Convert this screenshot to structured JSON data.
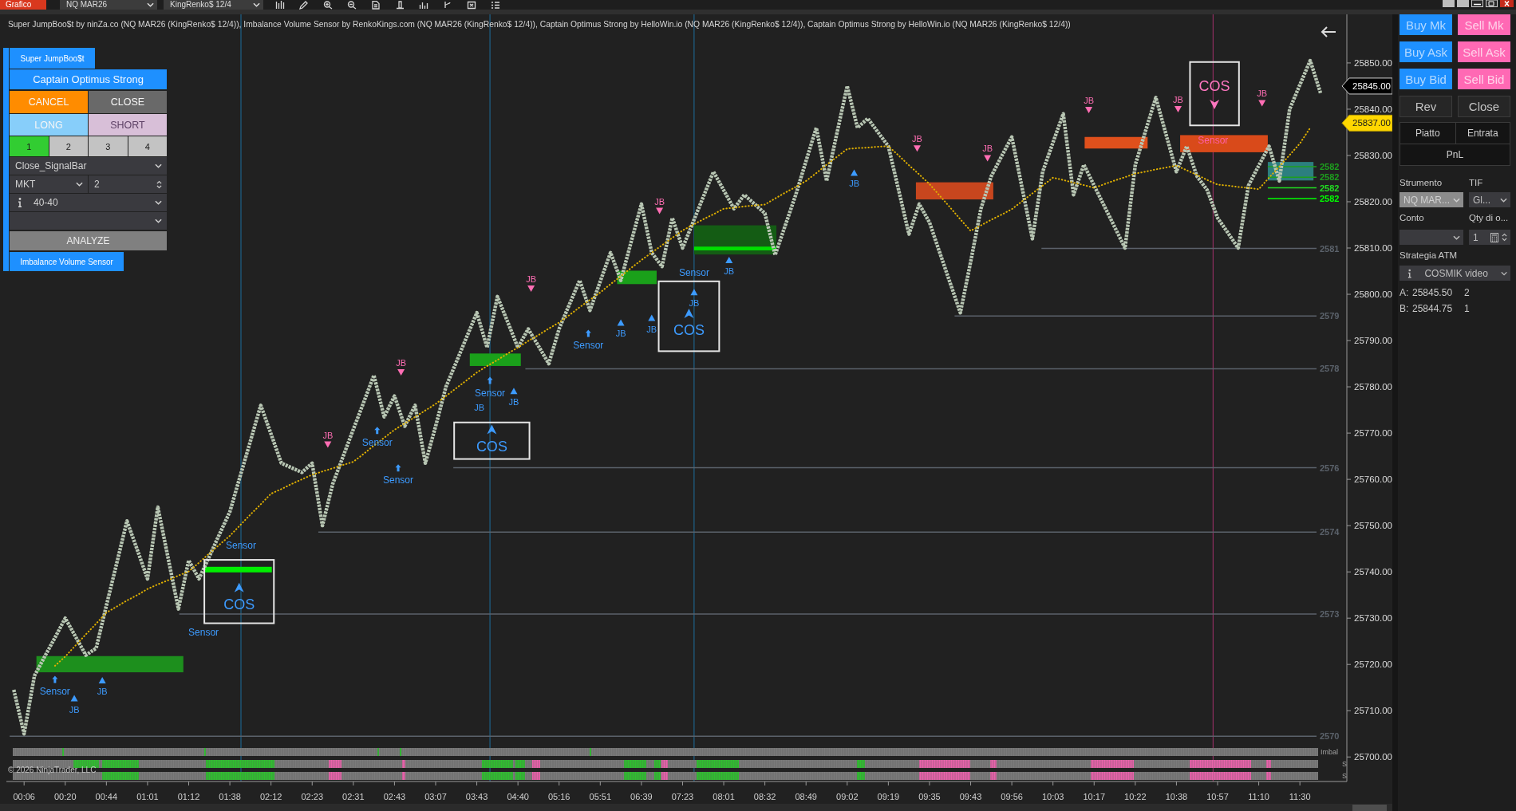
{
  "toolbar": {
    "tab": "Grafico",
    "instrument": "NQ MAR26",
    "bar_type": "KingRenko$ 12/4"
  },
  "chart": {
    "legend": "Super JumpBoo$t by ninZa.co (NQ MAR26 (KingRenko$ 12/4)), Imbalance Volume Sensor by RenkoKings.com (NQ MAR26 (KingRenko$ 12/4)), Captain Optimus Strong by HelloWin.io (NQ MAR26 (KingRenko$ 12/4)), Captain Optimus Strong by HelloWin.io (NQ MAR26 (KingRenko$ 12/4))",
    "strategy_panel": {
      "tab": "Super JumpBoo$t",
      "title": "Captain Optimus Strong",
      "actions": [
        {
          "label": "CANCEL",
          "color": "#ff8c00"
        },
        {
          "label": "CLOSE",
          "color": "#696969"
        },
        {
          "label": "LONG",
          "color": "#87cefa"
        },
        {
          "label": "SHORT",
          "color": "#d8bfd8"
        }
      ],
      "presets": [
        {
          "label": "1",
          "selected": true
        },
        {
          "label": "2",
          "selected": false
        },
        {
          "label": "3",
          "selected": false
        },
        {
          "label": "4",
          "selected": false
        }
      ],
      "exit_mode": "Close_SignalBar",
      "order_type": "MKT",
      "quantity": "2",
      "bracket": "40-40",
      "analyze": "ANALYZE"
    },
    "indicator_tab": "Imbalance Volume Sensor",
    "chart_data": {
      "type": "line",
      "categories": [
        null,
        null,
        "00:06",
        null,
        null,
        null,
        "00:20",
        null,
        null,
        null,
        "00:44",
        null,
        null,
        null,
        "01:01",
        null,
        null,
        null,
        "01:12",
        null,
        null,
        null,
        "01:38",
        null,
        null,
        null,
        "02:12",
        null,
        null,
        null,
        "02:23",
        null,
        null,
        null,
        "02:31",
        null,
        null,
        null,
        "02:43",
        null,
        null,
        null,
        "03:07",
        null,
        null,
        null,
        "03:43",
        null,
        null,
        null,
        "04:40",
        null,
        null,
        null,
        "05:16",
        null,
        null,
        null,
        "05:51",
        null,
        null,
        null,
        "06:39",
        null,
        null,
        null,
        "07:23",
        null,
        null,
        null,
        "08:01",
        null,
        null,
        null,
        "08:32",
        null,
        null,
        null,
        "08:49",
        null,
        null,
        null,
        "09:02",
        null,
        null,
        null,
        "09:19",
        null,
        null,
        null,
        "09:35",
        null,
        null,
        null,
        "09:43",
        null,
        null,
        null,
        "09:56",
        null,
        null,
        null,
        "10:03",
        null,
        null,
        null,
        "10:17",
        null,
        null,
        null,
        "10:22",
        null,
        null,
        null,
        "10:38",
        null,
        null,
        null,
        "10:57",
        null,
        null,
        null,
        "11:10",
        null,
        null,
        null,
        "11:30",
        null,
        null
      ],
      "ylim": [
        25694.7,
        25860.5
      ],
      "yticks": [
        {
          "value": 25700,
          "label": "25700.00"
        },
        {
          "value": 25710,
          "label": "25710.00"
        },
        {
          "value": 25720,
          "label": "25720.00"
        },
        {
          "value": 25730,
          "label": "25730.00"
        },
        {
          "value": 25740,
          "label": "25740.00"
        },
        {
          "value": 25750,
          "label": "25750.00"
        },
        {
          "value": 25760,
          "label": "25760.00"
        },
        {
          "value": 25770,
          "label": "25770.00"
        },
        {
          "value": 25780,
          "label": "25780.00"
        },
        {
          "value": 25790,
          "label": "25790.00"
        },
        {
          "value": 25800,
          "label": "25800.00"
        },
        {
          "value": 25810,
          "label": "25810.00"
        },
        {
          "value": 25820,
          "label": "25820.00"
        },
        {
          "value": 25830,
          "label": "25830.00"
        },
        {
          "value": 25840,
          "label": "25840.00"
        },
        {
          "value": 25850,
          "label": "25850.00"
        }
      ],
      "series": [
        {
          "color": "#b8c6b3",
          "line_style": "dashed",
          "values": [
            null,
            25714.5,
            25705,
            25717.5,
            25721.7,
            25725.8,
            25730,
            25726,
            25722,
            25723.5,
            25732.7,
            25741.8,
            25751,
            25744.8,
            25738.5,
            25754,
            25743,
            25732,
            25742.5,
            25738.5,
            25743.3,
            25748.2,
            25753,
            25760.7,
            25768.3,
            25776,
            25769.8,
            25763.5,
            25762.5,
            25761.5,
            25763.5,
            25750,
            25759,
            25764.9,
            25770.8,
            25776.6,
            25782.5,
            25773.5,
            25778,
            25771.5,
            25776,
            25763.5,
            25771.5,
            25780,
            25785.3,
            25790.7,
            25796,
            25788.5,
            25799.5,
            25794,
            25788.5,
            25792.5,
            25788.8,
            25785,
            25792.5,
            25797.8,
            25803,
            25796.5,
            25802.8,
            25809,
            25803,
            25811.3,
            25819.5,
            25809,
            25806,
            25816.5,
            25810,
            25815.5,
            25821,
            25826.5,
            25822.5,
            25818.5,
            25821.5,
            25819.5,
            25817.5,
            25808.5,
            25815,
            25821.5,
            25828.8,
            25836,
            25824.5,
            25834.8,
            25845,
            25836,
            25838,
            25835,
            25832,
            25822.5,
            25813,
            25819.5,
            25815.5,
            25809,
            25802.5,
            25796,
            25807,
            25818.5,
            25825.5,
            25829.8,
            25834,
            25823,
            25812,
            25826.5,
            25832.8,
            25839,
            25821.5,
            25828,
            25823.5,
            25819,
            25814.5,
            25810,
            25828,
            25835.3,
            25842.5,
            25834.5,
            25826.5,
            25832,
            25825.5,
            25822.5,
            25816.5,
            25813.3,
            25810,
            25823.5,
            25827.8,
            25832,
            25824.5,
            25840,
            25845.3,
            25850.5,
            25843.5
          ]
        },
        {
          "color": "#e0b000",
          "line_style": "dotted",
          "values": [
            null,
            null,
            null,
            null,
            null,
            25719.7,
            25721.7,
            25724.1,
            25726.5,
            25728.8,
            25731.2,
            25732.5,
            25733.8,
            25735,
            25736.3,
            25737.3,
            25738.2,
            25739.2,
            25740.1,
            25742,
            25744,
            25745.9,
            25747.8,
            25750.1,
            25752.4,
            25754.6,
            25756.9,
            25757.9,
            25759,
            25760,
            25761,
            25761.7,
            25762.4,
            25763.1,
            25763.8,
            25765.5,
            25767.3,
            25769,
            25770.7,
            25772.1,
            25773.5,
            25774.9,
            25776.3,
            25778,
            25779.7,
            25781.4,
            25783.1,
            25784.5,
            25785.8,
            25787.2,
            25788.5,
            25789.9,
            25791.2,
            25792.6,
            25793.9,
            25795.5,
            25797.2,
            25798.8,
            25800.4,
            25802.2,
            25803.9,
            25805.7,
            25807.4,
            25809,
            25810.6,
            25812.2,
            25813.8,
            25815,
            25816.2,
            25817.3,
            25818.5,
            25818.7,
            25819,
            25819.2,
            25819.4,
            25820.7,
            25822,
            25823.2,
            25824.5,
            25826.2,
            25828,
            25829.7,
            25831.4,
            25831.6,
            25831.7,
            25831.9,
            25832,
            25830,
            25827.9,
            25825.9,
            25823.8,
            25821.3,
            25818.8,
            25816.2,
            25813.7,
            25814.9,
            25816.1,
            25817.2,
            25818.4,
            25820.1,
            25821.8,
            25823.5,
            25825.2,
            25824.7,
            25824.1,
            25823.6,
            25823,
            25823.8,
            25824.6,
            25825.3,
            25826.1,
            25826.5,
            25827,
            25827.4,
            25827.8,
            25826.8,
            25825.8,
            25824.7,
            25823.7,
            25823.5,
            25823.2,
            25823,
            25822.7,
            25825.2,
            25827.6,
            25830.1,
            25832.6,
            25836,
            null
          ]
        }
      ],
      "annotations": [
        "2582",
        "2582",
        "2582",
        "2582",
        "2581",
        "2579",
        "2578",
        "2576",
        "2574",
        "2573",
        "2570",
        "JB",
        "JB",
        "JB",
        "JB",
        "JB",
        "JB",
        "JB",
        "JB",
        "JB",
        "JB",
        "JB",
        "JB",
        "JB",
        "JB",
        "JB",
        "JB",
        "JB",
        "JB",
        "Sensor",
        "Sensor",
        "Sensor",
        "Sensor",
        "Sensor",
        "Sensor",
        "Sensor",
        "Sensor",
        "Sensor",
        "COS",
        "COS",
        "COS",
        "COS",
        "25845.00",
        "25837.00"
      ]
    },
    "strip_labels": [
      "Imbal",
      "S",
      "S"
    ],
    "copyright": "© 2026 NinjaTrader, LLC"
  },
  "order_panel": {
    "quick_buttons": [
      {
        "label": "Buy Mk",
        "kind": "buy"
      },
      {
        "label": "Sell Mk",
        "kind": "sell"
      },
      {
        "label": "Buy Ask",
        "kind": "buy"
      },
      {
        "label": "Sell Ask",
        "kind": "sell"
      },
      {
        "label": "Buy Bid",
        "kind": "buy"
      },
      {
        "label": "Sell Bid",
        "kind": "sell"
      },
      {
        "label": "Rev",
        "kind": "neutral"
      },
      {
        "label": "Close",
        "kind": "neutral"
      }
    ],
    "position_columns": [
      "Piatto",
      "Entrata"
    ],
    "pnl": "PnL",
    "fields": {
      "instrument_label": "Strumento",
      "tif_label": "TIF",
      "instrument": {
        "value": "NQ MAR...",
        "disabled": true
      },
      "tif": "Gl...",
      "account_label": "Conto",
      "quantity_label": "Qty di o...",
      "quantity": "1",
      "atm_label": "Strategia ATM",
      "atm": "COSMIK video"
    },
    "quotes": [
      {
        "side": "A:",
        "price": "25845.50",
        "size": "2"
      },
      {
        "side": "B:",
        "price": "25844.75",
        "size": "1"
      }
    ]
  }
}
